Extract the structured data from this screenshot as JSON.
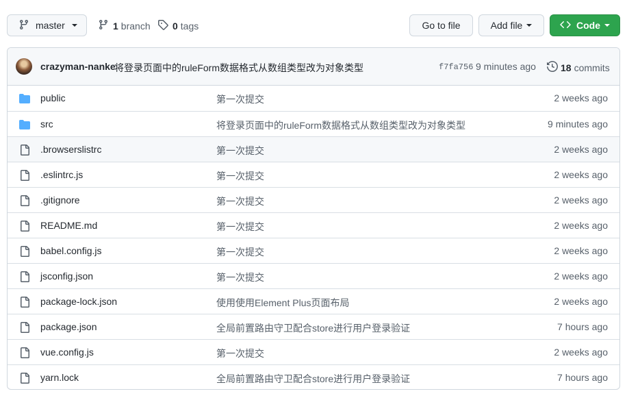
{
  "toolbar": {
    "branch_label": "master",
    "branches_count": "1",
    "branches_label": "branch",
    "tags_count": "0",
    "tags_label": "tags",
    "go_to_file_label": "Go to file",
    "add_file_label": "Add file",
    "code_label": "Code",
    "code_icon": "code-icon"
  },
  "latest_commit": {
    "author": "crazyman-nanke",
    "message": "将登录页面中的ruleForm数据格式从数组类型改为对象类型",
    "sha": "f7fa756",
    "time": "9 minutes ago",
    "commits_count": "18",
    "commits_label": "commits"
  },
  "files": [
    {
      "type": "dir",
      "icon": "folder-icon",
      "name": "public",
      "message": "第一次提交",
      "age": "2 weeks ago"
    },
    {
      "type": "dir",
      "icon": "folder-icon",
      "name": "src",
      "message": "将登录页面中的ruleForm数据格式从数组类型改为对象类型",
      "age": "9 minutes ago"
    },
    {
      "type": "file",
      "icon": "file-icon",
      "name": ".browserslistrc",
      "message": "第一次提交",
      "age": "2 weeks ago"
    },
    {
      "type": "file",
      "icon": "file-icon",
      "name": ".eslintrc.js",
      "message": "第一次提交",
      "age": "2 weeks ago"
    },
    {
      "type": "file",
      "icon": "file-icon",
      "name": ".gitignore",
      "message": "第一次提交",
      "age": "2 weeks ago"
    },
    {
      "type": "file",
      "icon": "file-icon",
      "name": "README.md",
      "message": "第一次提交",
      "age": "2 weeks ago"
    },
    {
      "type": "file",
      "icon": "file-icon",
      "name": "babel.config.js",
      "message": "第一次提交",
      "age": "2 weeks ago"
    },
    {
      "type": "file",
      "icon": "file-icon",
      "name": "jsconfig.json",
      "message": "第一次提交",
      "age": "2 weeks ago"
    },
    {
      "type": "file",
      "icon": "file-icon",
      "name": "package-lock.json",
      "message": "使用使用Element Plus页面布局",
      "age": "2 weeks ago"
    },
    {
      "type": "file",
      "icon": "file-icon",
      "name": "package.json",
      "message": "全局前置路由守卫配合store进行用户登录验证",
      "age": "7 hours ago"
    },
    {
      "type": "file",
      "icon": "file-icon",
      "name": "vue.config.js",
      "message": "第一次提交",
      "age": "2 weeks ago"
    },
    {
      "type": "file",
      "icon": "file-icon",
      "name": "yarn.lock",
      "message": "全局前置路由守卫配合store进行用户登录验证",
      "age": "7 hours ago"
    }
  ],
  "colors": {
    "accent_green": "#2da44e",
    "folder_blue": "#54aeff",
    "muted_text": "#57606a"
  }
}
